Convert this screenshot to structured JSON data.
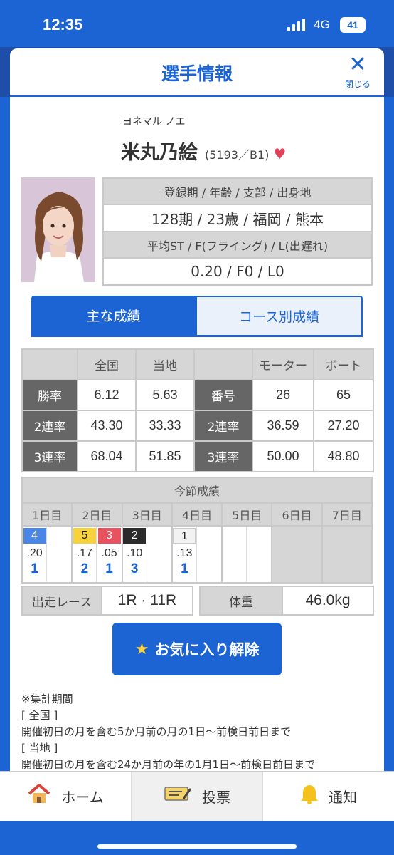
{
  "status": {
    "time": "12:35",
    "network": "4G",
    "battery": "41"
  },
  "modal": {
    "title": "選手情報",
    "close_label": "閉じる"
  },
  "racer": {
    "kana": "ヨネマル ノエ",
    "name": "米丸乃絵",
    "code": "(5193／B1)",
    "heart_icon": "heart-icon"
  },
  "profile": {
    "h1": "登録期 / 年齢 / 支部 / 出身地",
    "v1": "128期 / 23歳 / 福岡 / 熊本",
    "h2": "平均ST / F(フライング) / L(出遅れ)",
    "v2": "0.20 / F0 / L0"
  },
  "tabs": [
    "主な成績",
    "コース別成績"
  ],
  "stats": {
    "headers": [
      "全国",
      "当地",
      "モーター",
      "ボート"
    ],
    "rows": [
      {
        "label": "勝率",
        "national": "6.12",
        "local": "5.63",
        "mlabel": "番号",
        "motor": "26",
        "boat": "65"
      },
      {
        "label": "2連率",
        "national": "43.30",
        "local": "33.33",
        "mlabel": "2連率",
        "motor": "36.59",
        "boat": "27.20"
      },
      {
        "label": "3連率",
        "national": "68.04",
        "local": "51.85",
        "mlabel": "3連率",
        "motor": "50.00",
        "boat": "48.80"
      }
    ]
  },
  "session": {
    "title": "今節成績",
    "days": [
      "1日目",
      "2日目",
      "3日目",
      "4日目",
      "5日目",
      "6日目",
      "7日目"
    ],
    "races": [
      [
        {
          "lane": "4",
          "st": ".20",
          "rank": "1",
          "color": "#4a86e8"
        }
      ],
      [
        {
          "lane": "5",
          "st": ".17",
          "rank": "2",
          "color": "#f7d23b"
        },
        {
          "lane": "3",
          "st": ".05",
          "rank": "1",
          "color": "#e8525e"
        }
      ],
      [
        {
          "lane": "2",
          "st": ".10",
          "rank": "3",
          "color": "#2b2b2b"
        }
      ],
      [
        {
          "lane": "1",
          "st": ".13",
          "rank": "1",
          "color": "#f2f2f2"
        }
      ]
    ]
  },
  "misc": {
    "races_label": "出走レース",
    "races_value": "1R · 11R",
    "weight_label": "体重",
    "weight_value": "46.0kg"
  },
  "fav_button": "お気に入り解除",
  "notes": [
    "※集計期間",
    "[ 全国 ]",
    "開催初日の月を含む5か月前の月の1日～前検日前日まで",
    "[ 当地 ]",
    "開催初日の月を含む24か月前の年の1月1日～前検日前日まで"
  ],
  "nav": [
    "ホーム",
    "投票",
    "通知"
  ]
}
